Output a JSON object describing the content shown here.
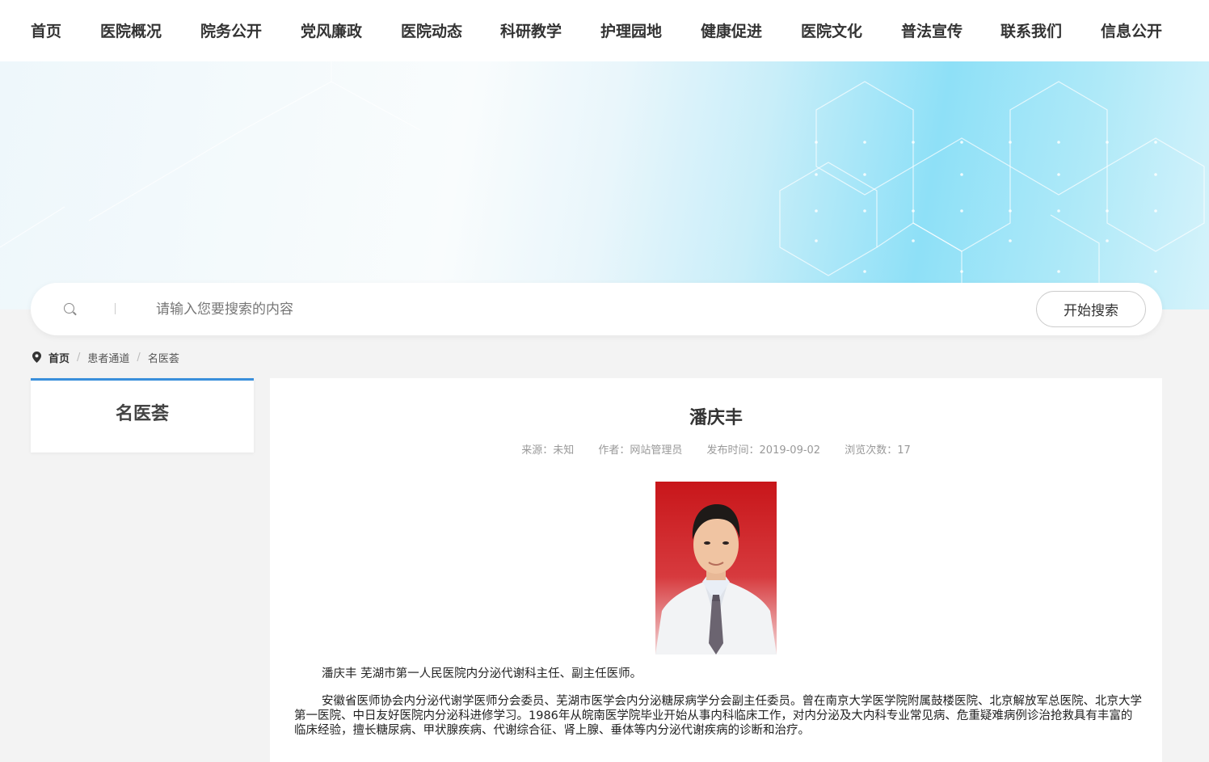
{
  "nav": {
    "items": [
      {
        "label": "首页"
      },
      {
        "label": "医院概况"
      },
      {
        "label": "院务公开"
      },
      {
        "label": "党风廉政"
      },
      {
        "label": "医院动态"
      },
      {
        "label": "科研教学"
      },
      {
        "label": "护理园地"
      },
      {
        "label": "健康促进"
      },
      {
        "label": "医院文化"
      },
      {
        "label": "普法宣传"
      },
      {
        "label": "联系我们"
      },
      {
        "label": "信息公开"
      }
    ]
  },
  "search": {
    "placeholder": "请输入您要搜索的内容",
    "button_label": "开始搜索",
    "icon": "search-icon"
  },
  "breadcrumb": {
    "icon": "location-pin-icon",
    "items": [
      "首页",
      "患者通道",
      "名医荟"
    ],
    "separator": "/"
  },
  "sidebar": {
    "title": "名医荟",
    "accent_color": "#3a8fdb"
  },
  "article": {
    "title": "潘庆丰",
    "meta": {
      "source": "来源：未知",
      "author": "作者：网站管理员",
      "date": "发布时间：2019-09-02",
      "views": "浏览次数：17"
    },
    "paragraphs": [
      "潘庆丰 芜湖市第一人民医院内分泌代谢科主任、副主任医师。",
      "安徽省医师协会内分泌代谢学医师分会委员、芜湖市医学会内分泌糖尿病学分会副主任委员。曾在南京大学医学院附属鼓楼医院、北京解放军总医院、北京大学第一医院、中日友好医院内分泌科进修学习。1986年从皖南医学院毕业开始从事内科临床工作，对内分泌及大内科专业常见病、危重疑难病例诊治抢救具有丰富的临床经验，擅长糖尿病、甲状腺疾病、代谢综合征、肾上腺、垂体等内分泌代谢疾病的诊断和治疗。"
    ]
  }
}
